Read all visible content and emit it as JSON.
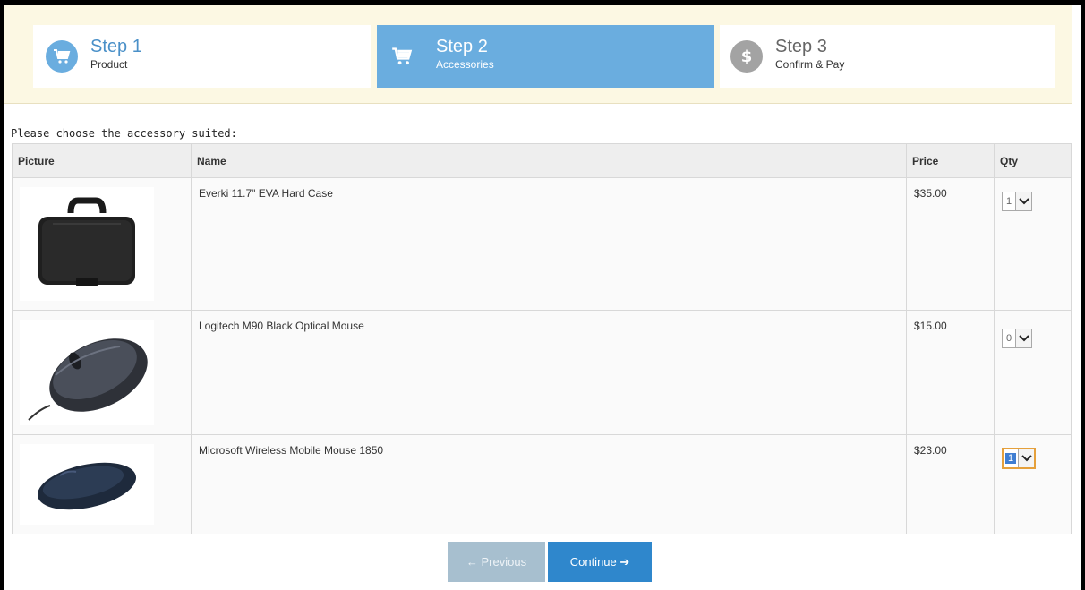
{
  "steps": [
    {
      "title": "Step 1",
      "subtitle": "Product"
    },
    {
      "title": "Step 2",
      "subtitle": "Accessories"
    },
    {
      "title": "Step 3",
      "subtitle": "Confirm & Pay"
    }
  ],
  "instructions": "Please choose the accessory suited:",
  "table": {
    "headers": {
      "picture": "Picture",
      "name": "Name",
      "price": "Price",
      "qty": "Qty"
    },
    "rows": [
      {
        "name": "Everki 11.7\" EVA Hard Case",
        "price": "$35.00",
        "qty": "1",
        "image": "laptop-case-image"
      },
      {
        "name": "Logitech M90 Black Optical Mouse",
        "price": "$15.00",
        "qty": "0",
        "image": "optical-mouse-image"
      },
      {
        "name": "Microsoft Wireless Mobile Mouse 1850",
        "price": "$23.00",
        "qty": "1",
        "image": "wireless-mouse-image"
      }
    ]
  },
  "buttons": {
    "previous": "← Previous",
    "continue": "Continue ➔"
  },
  "colors": {
    "accent": "#6aaddf",
    "banner": "#fcf8e3",
    "primary_button": "#2f87cc",
    "disabled_button": "#a7bfcf",
    "focus": "#e5a03b"
  }
}
